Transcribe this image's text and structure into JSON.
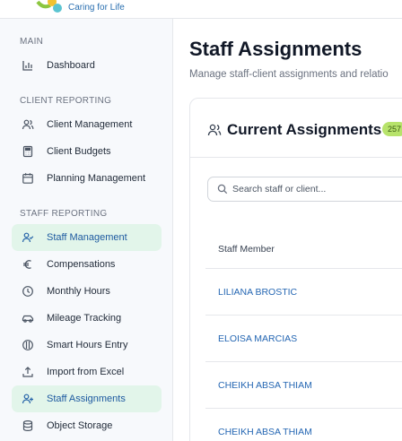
{
  "brand": {
    "tagline": "Caring for Life",
    "colors": {
      "accent": "#2563a8",
      "active_bg": "#e2f5ea",
      "badge": "#b7e36b"
    }
  },
  "sidebar": {
    "sections": [
      {
        "label": "MAIN"
      },
      {
        "label": "CLIENT REPORTING"
      },
      {
        "label": "STAFF REPORTING"
      }
    ],
    "items": [
      {
        "label": "Dashboard",
        "icon": "bar-chart-icon"
      },
      {
        "label": "Client Management",
        "icon": "users-icon"
      },
      {
        "label": "Client Budgets",
        "icon": "calculator-icon"
      },
      {
        "label": "Planning Management",
        "icon": "calendar-icon"
      },
      {
        "label": "Staff Management",
        "icon": "user-check-icon",
        "active": true
      },
      {
        "label": "Compensations",
        "icon": "euro-icon"
      },
      {
        "label": "Monthly Hours",
        "icon": "clock-icon"
      },
      {
        "label": "Mileage Tracking",
        "icon": "car-icon"
      },
      {
        "label": "Smart Hours Entry",
        "icon": "smart-icon"
      },
      {
        "label": "Import from Excel",
        "icon": "upload-icon"
      },
      {
        "label": "Staff Assignments",
        "icon": "user-plus-icon",
        "active": true
      },
      {
        "label": "Object Storage",
        "icon": "database-icon"
      }
    ]
  },
  "main": {
    "title": "Staff Assignments",
    "subtitle": "Manage staff-client assignments and relatio",
    "card": {
      "title": "Current Assignments",
      "count": "257",
      "search_placeholder": "Search staff or client...",
      "columns": [
        "Staff Member"
      ],
      "rows": [
        {
          "staff": "LILIANA BROSTIC"
        },
        {
          "staff": "ELOISA MARCIAS"
        },
        {
          "staff": "CHEIKH ABSA THIAM"
        },
        {
          "staff": "CHEIKH ABSA THIAM"
        }
      ]
    }
  }
}
